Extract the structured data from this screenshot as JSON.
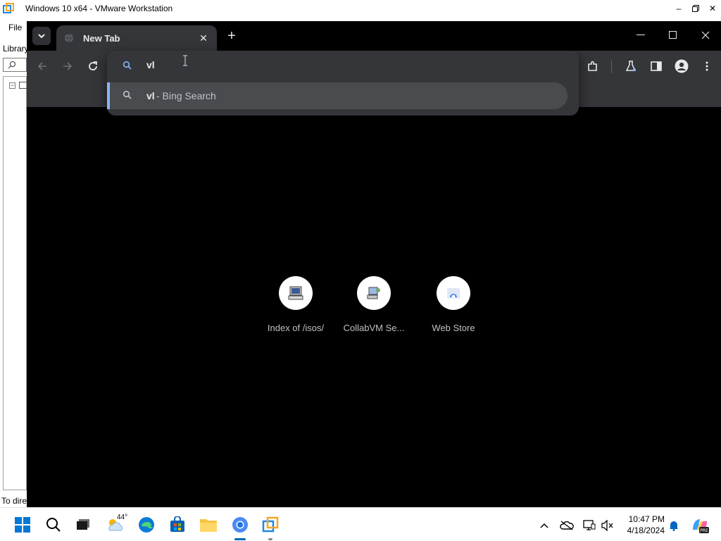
{
  "vmware": {
    "title": "Windows 10 x64 - VMware Workstation",
    "menu_file": "File",
    "library_label": "Library",
    "status_text": "To dire"
  },
  "browser": {
    "tab_title": "New Tab",
    "omnibox_value": "vl",
    "suggestion_query": "vl",
    "suggestion_suffix": "- Bing Search",
    "shortcuts": [
      {
        "label": "Index of /isos/"
      },
      {
        "label": "CollabVM Se..."
      },
      {
        "label": "Web Store"
      }
    ]
  },
  "taskbar": {
    "weather_temp": "44°",
    "time": "10:47 PM",
    "date": "4/18/2024",
    "accent": "#0067c0"
  }
}
